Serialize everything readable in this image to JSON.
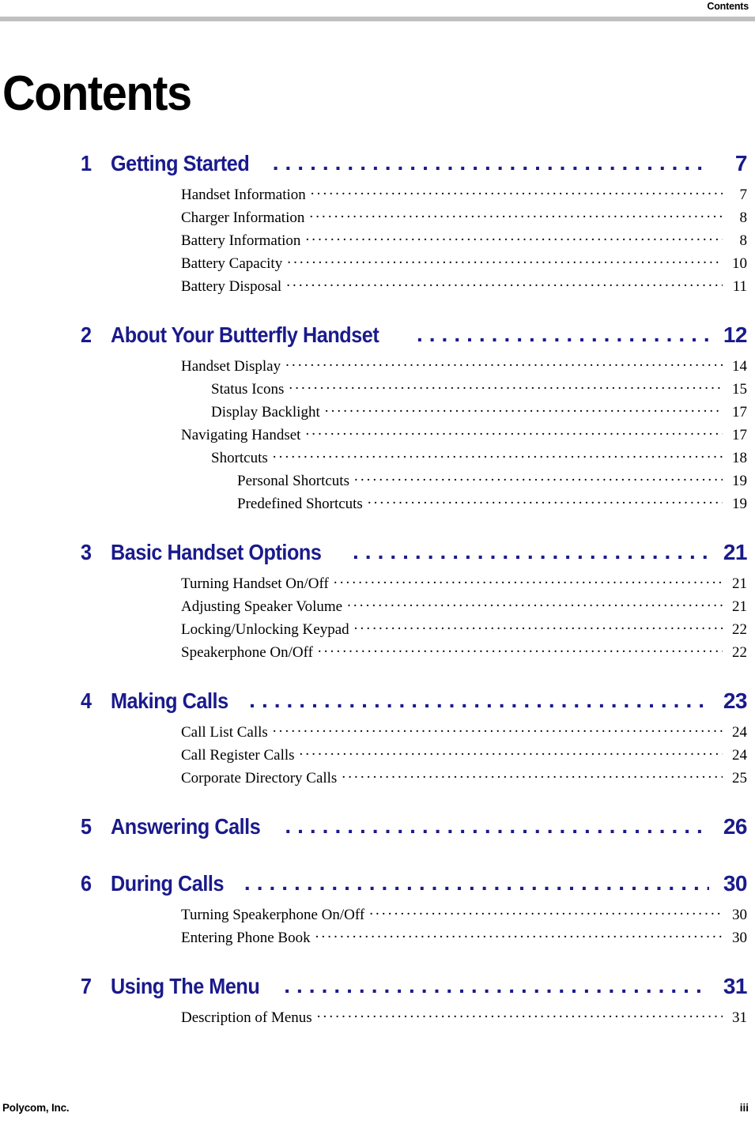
{
  "header": {
    "running_title": "Contents",
    "rule_color": "#c0c0c0"
  },
  "title": "Contents",
  "colors": {
    "chapter_blue": "#1a1a8c",
    "body_black": "#000000",
    "rule_gray": "#c0c0c0"
  },
  "toc": {
    "chapters": [
      {
        "number": "1",
        "title": "Getting Started",
        "page": "7",
        "entries": [
          {
            "level": 1,
            "title": "Handset Information",
            "page": "7"
          },
          {
            "level": 1,
            "title": "Charger Information",
            "page": "8"
          },
          {
            "level": 1,
            "title": "Battery Information",
            "page": "8"
          },
          {
            "level": 1,
            "title": "Battery Capacity",
            "page": "10"
          },
          {
            "level": 1,
            "title": "Battery Disposal",
            "page": "11"
          }
        ]
      },
      {
        "number": "2",
        "title": "About Your Butterfly Handset",
        "page": "12",
        "entries": [
          {
            "level": 1,
            "title": "Handset Display",
            "page": "14"
          },
          {
            "level": 2,
            "title": "Status Icons",
            "page": "15"
          },
          {
            "level": 2,
            "title": "Display Backlight",
            "page": "17"
          },
          {
            "level": 1,
            "title": "Navigating Handset",
            "page": "17"
          },
          {
            "level": 2,
            "title": "Shortcuts",
            "page": "18"
          },
          {
            "level": 3,
            "title": "Personal Shortcuts",
            "page": "19"
          },
          {
            "level": 3,
            "title": "Predefined Shortcuts",
            "page": "19"
          }
        ]
      },
      {
        "number": "3",
        "title": "Basic Handset Options",
        "page": "21",
        "entries": [
          {
            "level": 1,
            "title": "Turning Handset On/Off",
            "page": "21"
          },
          {
            "level": 1,
            "title": "Adjusting Speaker Volume",
            "page": "21"
          },
          {
            "level": 1,
            "title": "Locking/Unlocking Keypad",
            "page": "22"
          },
          {
            "level": 1,
            "title": "Speakerphone On/Off",
            "page": "22"
          }
        ]
      },
      {
        "number": "4",
        "title": "Making Calls",
        "page": "23",
        "entries": [
          {
            "level": 1,
            "title": "Call List Calls",
            "page": "24"
          },
          {
            "level": 1,
            "title": "Call Register Calls",
            "page": "24"
          },
          {
            "level": 1,
            "title": "Corporate Directory Calls",
            "page": "25"
          }
        ]
      },
      {
        "number": "5",
        "title": "Answering Calls",
        "page": "26",
        "entries": []
      },
      {
        "number": "6",
        "title": "During Calls",
        "page": "30",
        "entries": [
          {
            "level": 1,
            "title": "Turning Speakerphone On/Off",
            "page": "30"
          },
          {
            "level": 1,
            "title": "Entering Phone Book",
            "page": "30"
          }
        ]
      },
      {
        "number": "7",
        "title": "Using The Menu",
        "page": "31",
        "entries": [
          {
            "level": 1,
            "title": "Description of Menus",
            "page": "31"
          }
        ]
      }
    ]
  },
  "footer": {
    "left": "Polycom, Inc.",
    "right": "iii"
  }
}
